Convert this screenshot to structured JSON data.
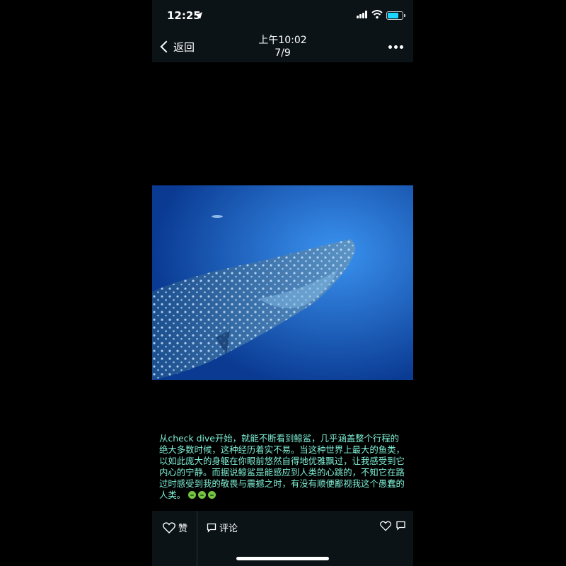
{
  "status": {
    "time": "12:25",
    "battery_level": 0.85
  },
  "nav": {
    "back_label": "返回",
    "title_time": "上午10:02",
    "page_index": "7/9"
  },
  "caption": {
    "text": "从check dive开始，就能不断看到鲸鲨，几乎涵盖整个行程的绝大多数时候，这种经历着实不易。当这种世界上最大的鱼类，以如此庞大的身躯在你眼前悠然自得地优雅飘过，让我感受到它内心的宁静。而据说鲸鲨是能感应到人类的心跳的，不知它在路过时感受到我的敬畏与震撼之时，有没有顺便鄙视我这个愚蠢的人类。"
  },
  "actions": {
    "like_label": "赞",
    "comment_label": "评论"
  },
  "colors": {
    "caption": "#7ff0d6",
    "bars": "#0b1317",
    "water": "#1663c9"
  },
  "icons": [
    "location-arrow-icon",
    "cell-signal-icon",
    "wifi-icon",
    "battery-icon",
    "chevron-left-icon",
    "more-dots-icon",
    "heart-icon",
    "comment-icon",
    "emoji-icon"
  ]
}
